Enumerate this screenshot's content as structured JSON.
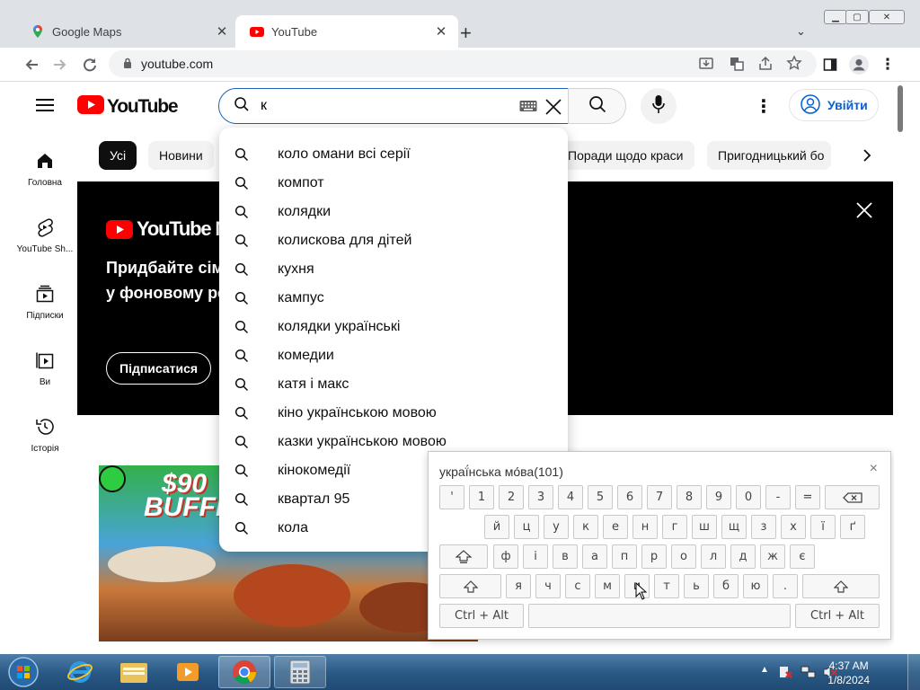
{
  "browser": {
    "tabs": [
      {
        "title": "Google Maps",
        "icon": "maps-pin-icon"
      },
      {
        "title": "YouTube",
        "icon": "youtube-icon",
        "active": true
      }
    ],
    "url": "youtube.com"
  },
  "youtube": {
    "logo_text": "YouTube",
    "search_value": "к",
    "signin_label": "Увійти",
    "sidebar": [
      {
        "label": "Головна",
        "icon": "home-icon"
      },
      {
        "label": "YouTube Sh...",
        "icon": "shorts-icon"
      },
      {
        "label": "Підписки",
        "icon": "subscriptions-icon"
      },
      {
        "label": "Ви",
        "icon": "you-icon"
      },
      {
        "label": "Історія",
        "icon": "history-icon"
      }
    ],
    "chips": [
      "Усі",
      "Новини",
      "Поради щодо краси",
      "Пригодницький бо"
    ],
    "banner": {
      "logo_text": "YouTube M",
      "headline_line1": "Придбайте сім",
      "headline_line2": "у фоновому ре",
      "subscribe_label": "Підписатися"
    },
    "thumbnail": {
      "text1": "$90",
      "text2": "BUFFE"
    }
  },
  "suggestions": [
    "коло омани всі серії",
    "компот",
    "колядки",
    "колискова для дітей",
    "кухня",
    "кампус",
    "колядки українські",
    "комедии",
    "катя і макс",
    "кіно українською мовою",
    "казки українською мовою",
    "кінокомедії",
    "квартал 95",
    "кола"
  ],
  "keyboard": {
    "title": "украї́нська мо́ва(101)",
    "close": "×",
    "row1": [
      "'",
      "1",
      "2",
      "3",
      "4",
      "5",
      "6",
      "7",
      "8",
      "9",
      "0",
      "-",
      "="
    ],
    "row2": [
      "й",
      "ц",
      "у",
      "к",
      "е",
      "н",
      "г",
      "ш",
      "щ",
      "з",
      "х",
      "ї",
      "ґ"
    ],
    "row3": [
      "ф",
      "і",
      "в",
      "а",
      "п",
      "р",
      "о",
      "л",
      "д",
      "ж",
      "є"
    ],
    "row4": [
      "я",
      "ч",
      "с",
      "м",
      "и",
      "т",
      "ь",
      "б",
      "ю",
      "."
    ],
    "ctrl_alt": "Ctrl + Alt"
  },
  "taskbar": {
    "time": "4:37 AM",
    "date": "1/8/2024"
  },
  "colors": {
    "yt_red": "#ff0000",
    "link_blue": "#065fd4",
    "focus_blue": "#1c62b9"
  }
}
